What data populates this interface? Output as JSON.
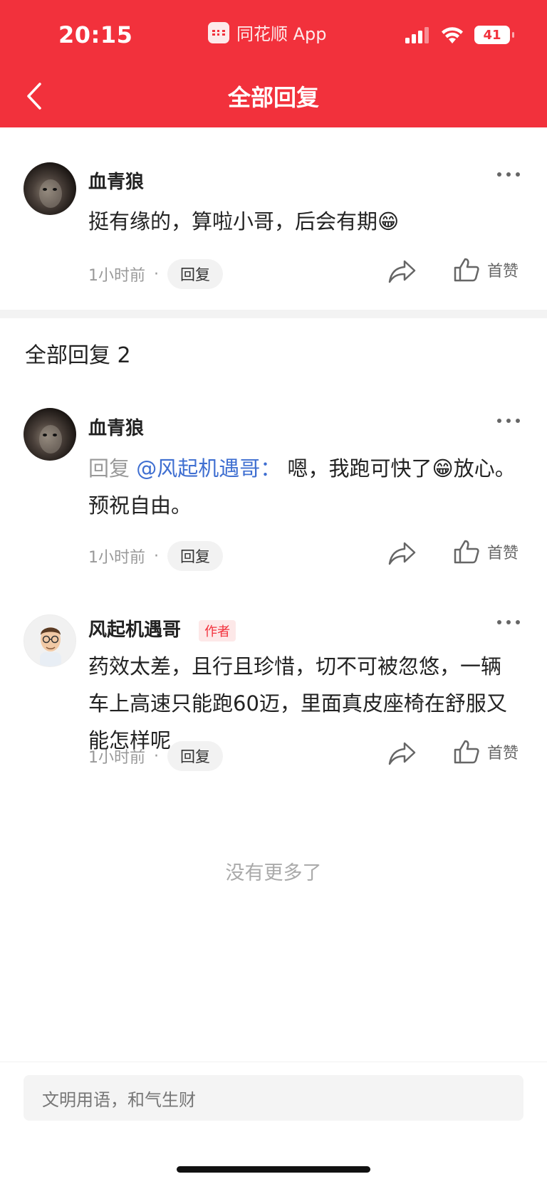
{
  "status_bar": {
    "time": "20:15",
    "app_name": "同花顺 App",
    "battery": "41"
  },
  "header": {
    "title": "全部回复",
    "back_icon": "chevron-left-icon"
  },
  "colors": {
    "brand": "#f2313c",
    "mention": "#3f6fd1",
    "meta": "#999999"
  },
  "main_comment": {
    "username": "血青狼",
    "text": "挺有缘的，算啦小哥，后会有期😁",
    "time": "1小时前",
    "reply_label": "回复",
    "like_label": "首赞"
  },
  "replies_section": {
    "title": "全部回复 2"
  },
  "replies": [
    {
      "username": "血青狼",
      "reply_prefix": "回复",
      "mention": "@风起机遇哥：",
      "text": "嗯，我跑可快了😁放心。预祝自由。",
      "time": "1小时前",
      "reply_label": "回复",
      "like_label": "首赞"
    },
    {
      "username": "风起机遇哥",
      "badge": "作者",
      "text": "药效太差，且行且珍惜，切不可被忽悠，一辆车上高速只能跑60迈，里面真皮座椅在舒服又能怎样呢",
      "time": "1小时前",
      "reply_label": "回复",
      "like_label": "首赞"
    }
  ],
  "footer": {
    "no_more": "没有更多了"
  },
  "input": {
    "placeholder": "文明用语，和气生财"
  }
}
